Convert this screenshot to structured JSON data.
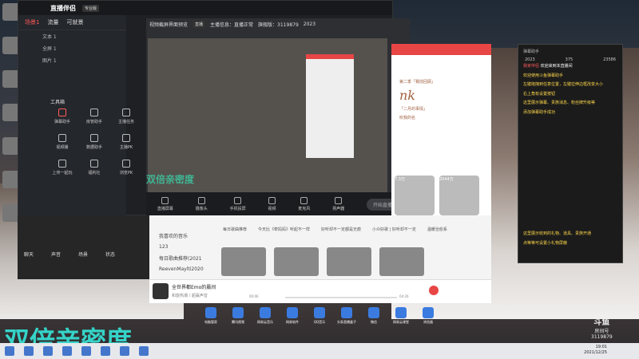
{
  "live_tool": {
    "app_name": "直播伴侣",
    "badge": "专业版",
    "tabs": [
      "场景1",
      "流量",
      "可就景"
    ],
    "sources": [
      "文本 1",
      "全屏 1",
      "图片 1"
    ],
    "toolbox_title": "工具箱",
    "tools": [
      "弹幕助手",
      "房管助手",
      "主播任务",
      "视频播",
      "数据助手",
      "主播PK",
      "上传一起玩",
      "福利社",
      "浏览PK",
      "游戏",
      "特效",
      "更多"
    ],
    "preview_tab": "视频截屏界面预览",
    "preview_tag": "直播",
    "preview_status": [
      "主播信息：直播正常",
      "旗舰版：3119879",
      "2023"
    ],
    "bottom_tools": [
      "直播屏幕",
      "摄像头",
      "手机投屏",
      "视频",
      "麦克风",
      "扬声器"
    ],
    "go_live": "开始直播"
  },
  "mixer_labels": [
    "聊天",
    "声音",
    "场景",
    "状态"
  ],
  "watermark_small": "双倍亲密度",
  "watermark_big": "双倍亲密度",
  "music": {
    "list": [
      "我喜欢的音乐",
      "123",
      "每日歌曲推荐(2021",
      "ReevenMaylti2020"
    ],
    "section_items": [
      "每日歌曲推荐",
      "今天比《牵妈妈》听起不一样",
      "好听却不一定都是无痕",
      "小众好歌 | 好听却不一定",
      "温暖治愈系"
    ],
    "song": "全世界都Emo的晨间",
    "artist": "和旋热潮 / 超赢声音",
    "time_current": "00:06",
    "time_total": "04:26"
  },
  "browser_text": [
    "第二季「赛前回顾」",
    "nk",
    "「二月的事情」",
    "叹我的名"
  ],
  "cards_counts": [
    "7.3万",
    "2044万"
  ],
  "chat": {
    "title": "弹幕助手",
    "stats": [
      "2023",
      "375",
      "23586"
    ],
    "welcome_user": "我家伴侣",
    "welcome_text": "欢迎来到本直播间",
    "messages": [
      "欢迎使用斗鱼弹幕助手",
      "左键拖拽到任意位置，左键拉伸边框改变大小",
      "右上角有设置按钮",
      "这里展示弹幕、贵族消息、粉丝牌升级等",
      "添加弹幕助手成功"
    ],
    "bottom_messages": [
      "这里展示收到的礼物、道具、贵族开通",
      "点等等可设置小礼物屏蔽"
    ]
  },
  "dock": [
    "电脑管家",
    "腾讯视频",
    "网易云音乐",
    "网易软件",
    "QQ音乐",
    "头条直播盒子",
    "微信",
    "网易云课堂",
    "浏览器"
  ],
  "room": {
    "label": "斗鱼",
    "sub": "房间号",
    "number": "3119879"
  },
  "clock": {
    "time": "19:01",
    "date": "2021/12/25"
  }
}
